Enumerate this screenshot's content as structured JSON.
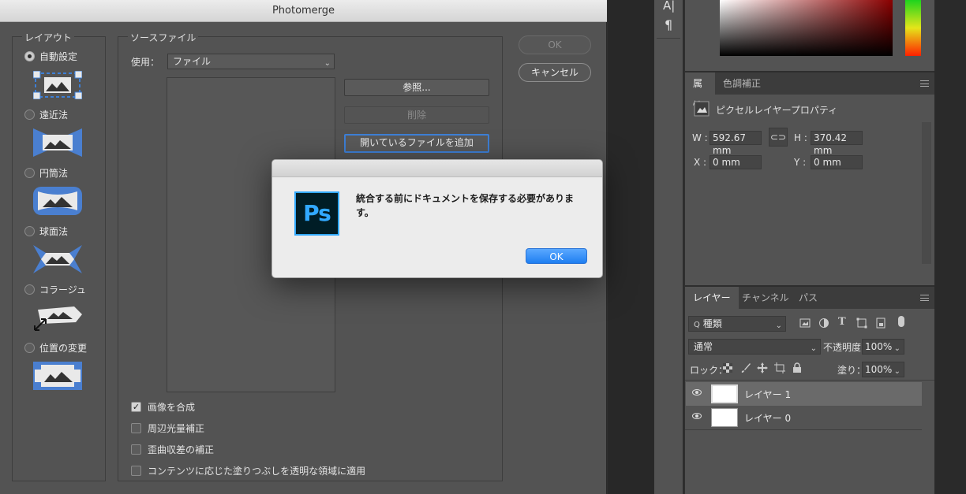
{
  "photomerge": {
    "title": "Photomerge",
    "layout_group": {
      "title": "レイアウト",
      "options": [
        {
          "label": "自動設定",
          "selected": true
        },
        {
          "label": "遠近法",
          "selected": false
        },
        {
          "label": "円筒法",
          "selected": false
        },
        {
          "label": "球面法",
          "selected": false
        },
        {
          "label": "コラージュ",
          "selected": false
        },
        {
          "label": "位置の変更",
          "selected": false
        }
      ]
    },
    "source_group": {
      "title": "ソースファイル",
      "use_label": "使用：",
      "use_value": "ファイル",
      "browse_button": "参照...",
      "delete_button": "削除",
      "add_open_button": "開いているファイルを追加"
    },
    "ok_button": "OK",
    "cancel_button": "キャンセル",
    "checkboxes": [
      {
        "label": "画像を合成",
        "checked": true
      },
      {
        "label": "周辺光量補正",
        "checked": false
      },
      {
        "label": "歪曲収差の補正",
        "checked": false
      },
      {
        "label": "コンテンツに応じた塗りつぶしを透明な領域に適用",
        "checked": false
      }
    ]
  },
  "alert": {
    "logo_text": "Ps",
    "message": "統合する前にドキュメントを保存する必要があります。",
    "ok_button": "OK"
  },
  "toolstrip": {
    "char_icon": "A|",
    "para_icon": "¶"
  },
  "properties_panel": {
    "tabs": [
      "属性",
      "色調補正"
    ],
    "subtitle": "ピクセルレイヤープロパティ",
    "w_label": "W :",
    "w_value": "592.67 mm",
    "h_label": "H :",
    "h_value": "370.42 mm",
    "x_label": "X :",
    "x_value": "0 mm",
    "y_label": "Y :",
    "y_value": "0 mm"
  },
  "layers_panel": {
    "tabs": [
      "レイヤー",
      "チャンネル",
      "パス"
    ],
    "filter_value": "種類",
    "blend_mode": "通常",
    "opacity_label": "不透明度：",
    "opacity_value": "100%",
    "lock_label": "ロック：",
    "fill_label": "塗り：",
    "fill_value": "100%",
    "layers": [
      {
        "name": "レイヤー 1",
        "selected": true
      },
      {
        "name": "レイヤー 0",
        "selected": false
      }
    ]
  },
  "colors": {
    "accent": "#1f7ff1",
    "panel_bg": "#535353",
    "ps_logo_blue": "#31a8ff"
  }
}
